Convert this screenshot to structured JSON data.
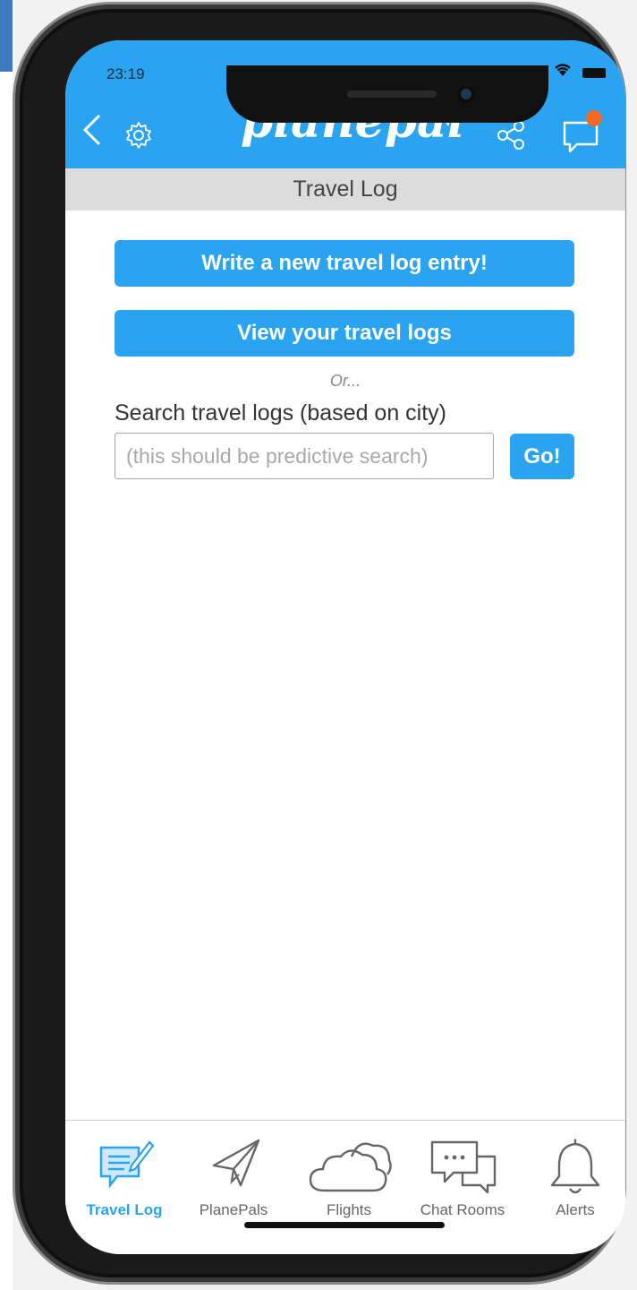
{
  "status": {
    "time": "23:19"
  },
  "header": {
    "logo": "planepal"
  },
  "page": {
    "title": "Travel Log"
  },
  "actions": {
    "write_label": "Write a new travel log entry!",
    "view_label": "View your travel logs"
  },
  "search": {
    "or_text": "Or...",
    "label": "Search travel logs (based on city)",
    "placeholder": "(this should be predictive search)",
    "value": "",
    "go_label": "Go!"
  },
  "tabs": [
    {
      "label": "Travel Log",
      "icon": "travel-log-icon",
      "active": true
    },
    {
      "label": "PlanePals",
      "icon": "paper-plane-icon",
      "active": false
    },
    {
      "label": "Flights",
      "icon": "cloud-icon",
      "active": false
    },
    {
      "label": "Chat Rooms",
      "icon": "chat-rooms-icon",
      "active": false
    },
    {
      "label": "Alerts",
      "icon": "bell-icon",
      "active": false
    }
  ],
  "colors": {
    "accent": "#2aa3f1",
    "subheader_bg": "#dcdcdc",
    "notification": "#f26a24"
  }
}
